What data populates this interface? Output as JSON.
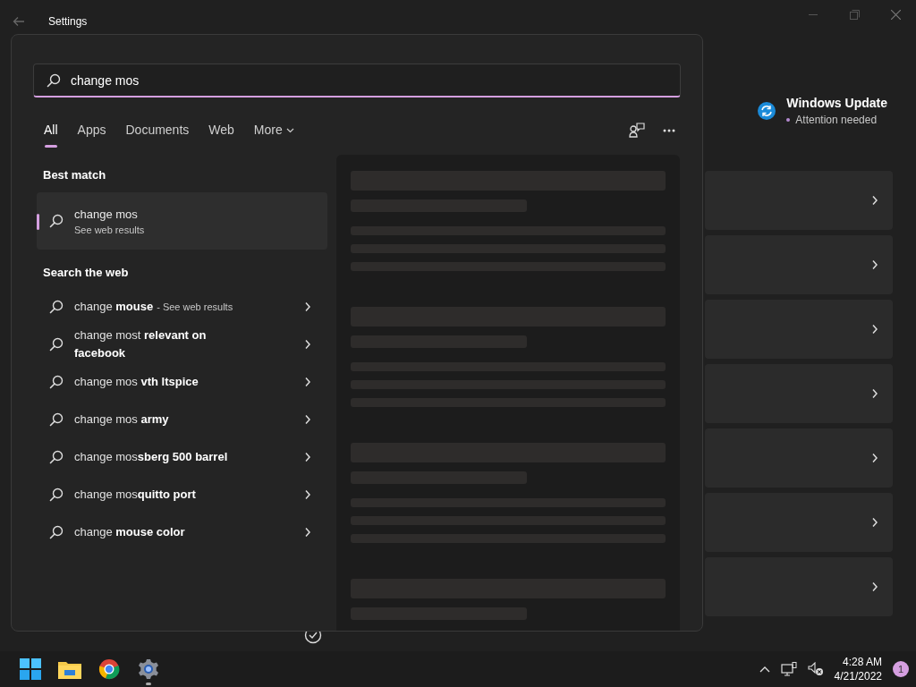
{
  "window": {
    "title": "Settings"
  },
  "update": {
    "title": "Windows Update",
    "status": "Attention needed"
  },
  "search": {
    "query": "change mos",
    "tabs": [
      {
        "label": "All",
        "selected": true,
        "kind": "tab"
      },
      {
        "label": "Apps",
        "selected": false,
        "kind": "tab"
      },
      {
        "label": "Documents",
        "selected": false,
        "kind": "tab"
      },
      {
        "label": "Web",
        "selected": false,
        "kind": "tab"
      },
      {
        "label": "More",
        "selected": false,
        "kind": "menu"
      }
    ],
    "best_match": {
      "heading": "Best match",
      "title": "change mos",
      "subtitle": "See web results",
      "selected": true
    },
    "web": {
      "heading": "Search the web",
      "items": [
        {
          "text": "change **mouse**",
          "suffix": "- See web results"
        },
        {
          "text": "change most **relevant on facebook**"
        },
        {
          "text": "change mos **vth ltspice**"
        },
        {
          "text": "change mos **army**"
        },
        {
          "text": "change mos**sberg 500 barrel**"
        },
        {
          "text": "change mos**quitto port**"
        },
        {
          "text": "change **mouse color**"
        }
      ]
    }
  },
  "taskbar": {
    "apps": [
      {
        "kind": "start",
        "running": false
      },
      {
        "kind": "explorer",
        "running": false
      },
      {
        "kind": "browser",
        "running": false
      },
      {
        "kind": "settings",
        "running": true
      }
    ],
    "time": "4:28 AM",
    "date": "4/21/2022",
    "notifications": "1"
  }
}
